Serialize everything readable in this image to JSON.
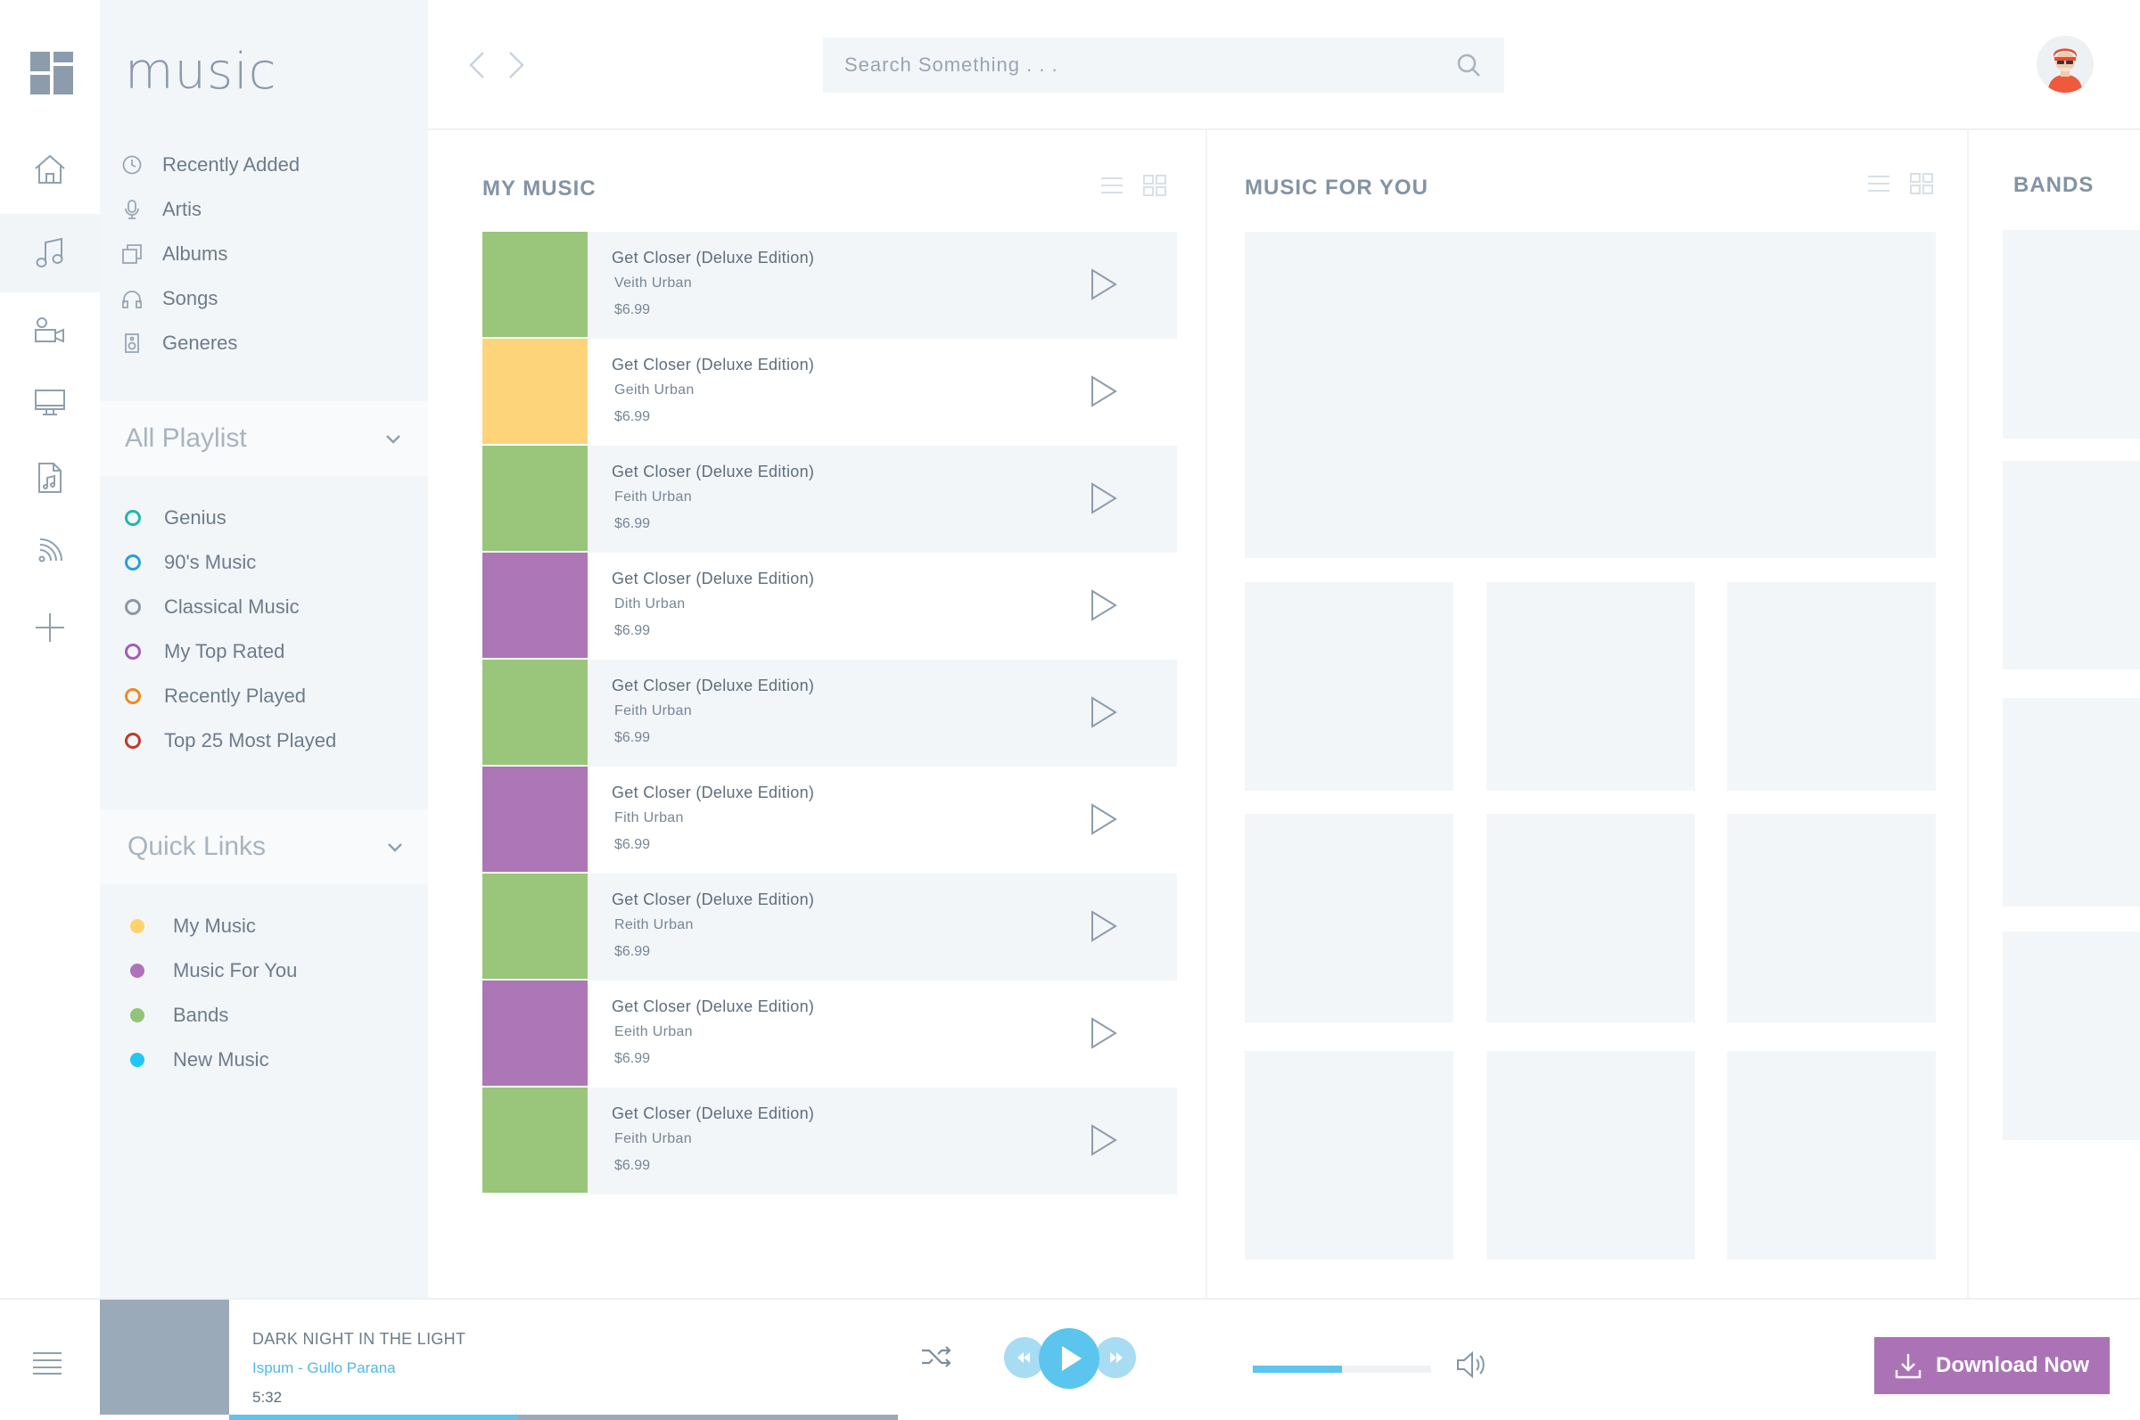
{
  "app": {
    "title": "music"
  },
  "nav": {
    "items": [
      {
        "label": "Recently Added",
        "icon": "clock-icon"
      },
      {
        "label": "Artis",
        "icon": "microphone-icon"
      },
      {
        "label": "Albums",
        "icon": "albums-icon"
      },
      {
        "label": "Songs",
        "icon": "headphones-icon"
      },
      {
        "label": "Generes",
        "icon": "speaker-icon"
      }
    ]
  },
  "playlist": {
    "header": "All Playlist",
    "items": [
      {
        "label": "Genius",
        "color": "#1fb8a6"
      },
      {
        "label": "90's Music",
        "color": "#2a9fd6"
      },
      {
        "label": "Classical Music",
        "color": "#8a98a6"
      },
      {
        "label": "My Top Rated",
        "color": "#a35cc0"
      },
      {
        "label": "Recently Played",
        "color": "#ef8a1f"
      },
      {
        "label": "Top 25 Most Played",
        "color": "#c0392b"
      }
    ]
  },
  "quick_links": {
    "header": "Quick Links",
    "items": [
      {
        "label": "My Music",
        "color": "#ffd36b"
      },
      {
        "label": "Music For You",
        "color": "#ad72b8"
      },
      {
        "label": "Bands",
        "color": "#93c47a"
      },
      {
        "label": "New Music",
        "color": "#1fc8f0"
      }
    ]
  },
  "search": {
    "placeholder": "Search Something . . ."
  },
  "my_music": {
    "title": "MY MUSIC",
    "tracks": [
      {
        "title": "Get Closer (Deluxe Edition)",
        "artist": "Veith Urban",
        "price": "$6.99",
        "cover_color": "#99c67b",
        "shaded": true
      },
      {
        "title": "Get Closer (Deluxe Edition)",
        "artist": "Geith Urban",
        "price": "$6.99",
        "cover_color": "#fdd47a",
        "shaded": false
      },
      {
        "title": "Get Closer (Deluxe Edition)",
        "artist": "Feith Urban",
        "price": "$6.99",
        "cover_color": "#99c67b",
        "shaded": true
      },
      {
        "title": "Get Closer (Deluxe Edition)",
        "artist": "Dith Urban",
        "price": "$6.99",
        "cover_color": "#ad76b6",
        "shaded": false
      },
      {
        "title": "Get Closer (Deluxe Edition)",
        "artist": "Feith Urban",
        "price": "$6.99",
        "cover_color": "#99c67b",
        "shaded": true
      },
      {
        "title": "Get Closer (Deluxe Edition)",
        "artist": "Fith Urban",
        "price": "$6.99",
        "cover_color": "#ad76b6",
        "shaded": false
      },
      {
        "title": "Get Closer (Deluxe Edition)",
        "artist": "Reith Urban",
        "price": "$6.99",
        "cover_color": "#99c67b",
        "shaded": true
      },
      {
        "title": "Get Closer (Deluxe Edition)",
        "artist": "Eeith Urban",
        "price": "$6.99",
        "cover_color": "#ad76b6",
        "shaded": false
      },
      {
        "title": "Get Closer (Deluxe Edition)",
        "artist": "Feith Urban",
        "price": "$6.99",
        "cover_color": "#99c67b",
        "shaded": true
      }
    ]
  },
  "music_for_you": {
    "title": "MUSIC FOR YOU"
  },
  "bands": {
    "title": "BANDS"
  },
  "player": {
    "title": "DARK NIGHT IN THE LIGHT",
    "artist": "Ispum - Gullo Parana",
    "time": "5:32",
    "volume_percent": 50,
    "progress_percent": 43,
    "download_label": "Download Now"
  },
  "colors": {
    "accent": "#5bc5ee",
    "download": "#ab73b6"
  }
}
